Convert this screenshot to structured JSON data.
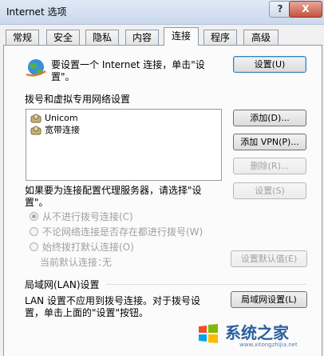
{
  "window": {
    "title": "Internet 选项",
    "help": "?",
    "close": "X"
  },
  "tabs": [
    {
      "label": "常规"
    },
    {
      "label": "安全"
    },
    {
      "label": "隐私"
    },
    {
      "label": "内容"
    },
    {
      "label": "连接",
      "active": true
    },
    {
      "label": "程序"
    },
    {
      "label": "高级"
    }
  ],
  "setup": {
    "line1": "要设置一个 Internet 连接，单击\"设",
    "line2": "置\"。",
    "button": "设置(U)"
  },
  "dialup": {
    "heading": "拨号和虚拟专用网络设置",
    "connections": [
      "Unicom",
      "宽带连接"
    ],
    "add_button": "添加(D)...",
    "add_vpn_button": "添加 VPN(P)...",
    "remove_button": "删除(R)...",
    "proxy_line1": "如果要为连接配置代理服务器，请选择\"设",
    "proxy_line2": "置\"。",
    "settings_button": "设置(S)",
    "options": [
      {
        "label": "从不进行拨号连接(C)",
        "checked": true
      },
      {
        "label": "不论网络连接是否存在都进行拨号(W)",
        "checked": false
      },
      {
        "label": "始终拨打默认连接(O)",
        "checked": false
      }
    ],
    "current_default_label": "当前默认连接：",
    "current_default_value": "无",
    "set_default_button": "设置默认值(E)"
  },
  "lan": {
    "heading": "局域网(LAN)设置",
    "line1": "LAN 设置不应用到拨号连接。对于拨号设",
    "line2": "置，单击上面的\"设置\"按钮。",
    "button": "局域网设置(L)"
  },
  "watermark": {
    "brand": "系统之家",
    "url": "www.xitongzhijia.net"
  },
  "colors": {
    "accent": "#3c7fb1",
    "disabled": "#a0a0a0"
  }
}
